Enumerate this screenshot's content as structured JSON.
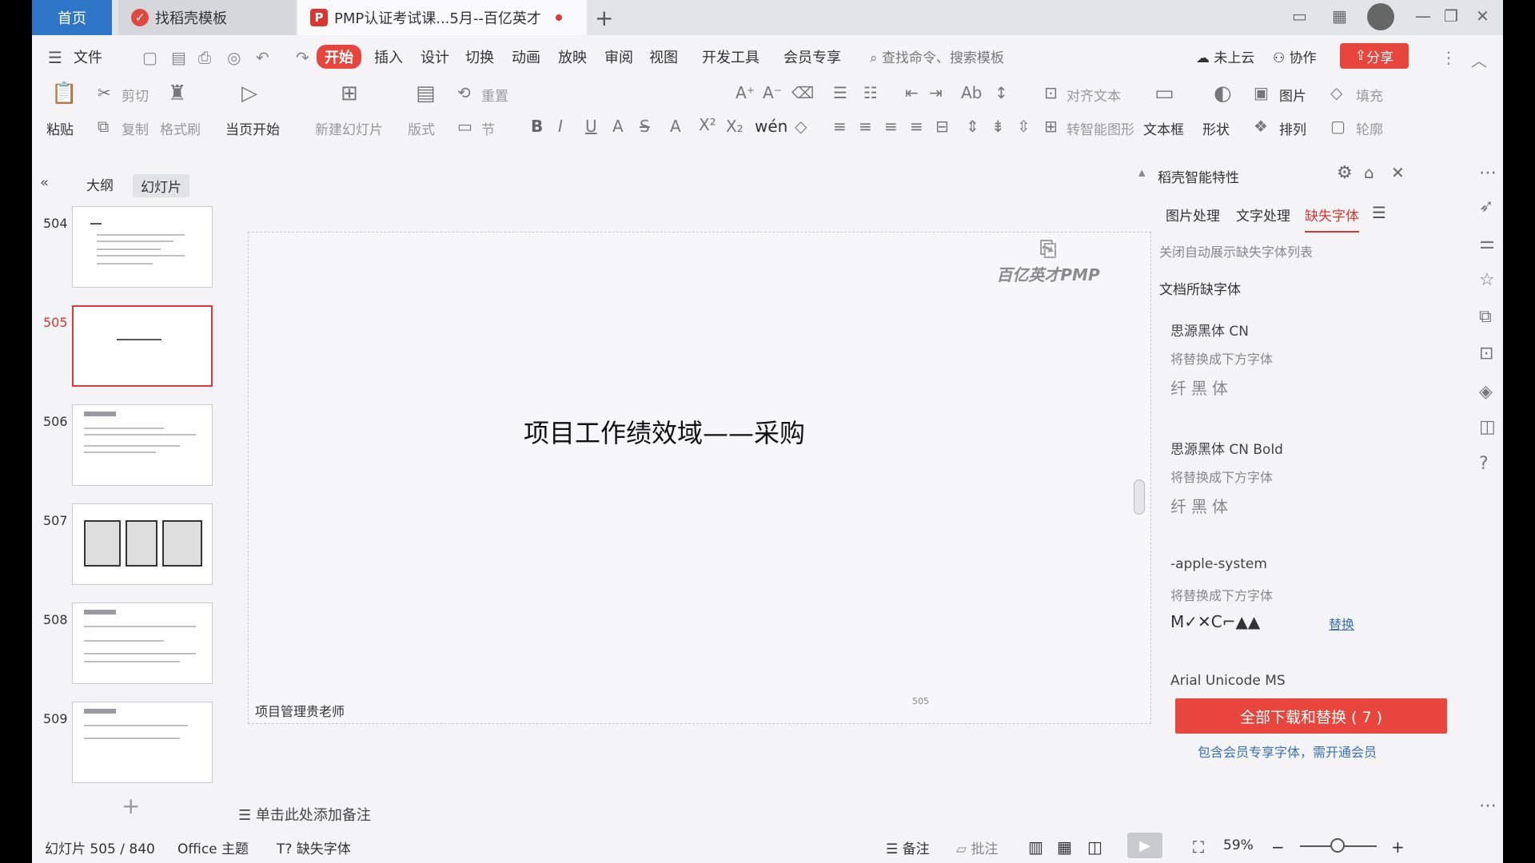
{
  "titlebar": {
    "tabs": [
      {
        "label": "首页"
      },
      {
        "label": "找稻壳模板"
      },
      {
        "label": "PMP认证考试课...5月--百亿英才"
      }
    ],
    "new_tab": "+"
  },
  "menu": {
    "file": "文件",
    "items": [
      "开始",
      "插入",
      "设计",
      "切换",
      "动画",
      "放映",
      "审阅",
      "视图",
      "开发工具",
      "会员专享"
    ],
    "search_placeholder": "查找命令、搜索模板",
    "cloud": "未上云",
    "collab": "协作",
    "share": "分享"
  },
  "ribbon": {
    "paste": "粘贴",
    "cut": "剪切",
    "copy": "复制",
    "format_painter": "格式刷",
    "play_from_current": "当页开始",
    "new_slide": "新建幻灯片",
    "layout": "版式",
    "reset": "重置",
    "section": "节",
    "align_text": "对齐文本",
    "smart_shape": "转智能图形",
    "text_box": "文本框",
    "shape": "形状",
    "picture": "图片",
    "arrange": "排列",
    "fill": "填充",
    "outline": "轮廓"
  },
  "left_panel": {
    "tab_outline": "大纲",
    "tab_slides": "幻灯片",
    "slides": [
      "504",
      "505",
      "506",
      "507",
      "508",
      "509"
    ],
    "selected": "505"
  },
  "slide": {
    "title": "项目工作绩效域——采购",
    "footer": "项目管理贵老师",
    "number": "505",
    "logo": "百亿英才PMP"
  },
  "notes_placeholder": "单击此处添加备注",
  "right_panel": {
    "header": "稻壳智能特性",
    "tabs": [
      "图片处理",
      "文字处理",
      "缺失字体"
    ],
    "active_tab": "缺失字体",
    "close_auto": "关闭自动展示缺失字体列表",
    "section_title": "文档所缺字体",
    "fonts": [
      {
        "name": "思源黑体 CN",
        "replace_label": "将替换成下方字体",
        "replacement": "纤黑体"
      },
      {
        "name": "思源黑体 CN Bold",
        "replace_label": "将替换成下方字体",
        "replacement": "纤黑体"
      },
      {
        "name": "-apple-system",
        "replace_label": "将替换成下方字体",
        "replacement": "M✓✕C⌐▲▲",
        "action": "替换"
      }
    ],
    "partial_font": "Arial Unicode MS",
    "download_button": "全部下载和替换 ( 7 )",
    "member_note": "包含会员专享字体，需开通会员"
  },
  "statusbar": {
    "slide_info": "幻灯片 505 / 840",
    "theme": "Office 主题",
    "missing_font": "缺失字体",
    "notes": "备注",
    "comments": "批注",
    "zoom": "59%"
  }
}
